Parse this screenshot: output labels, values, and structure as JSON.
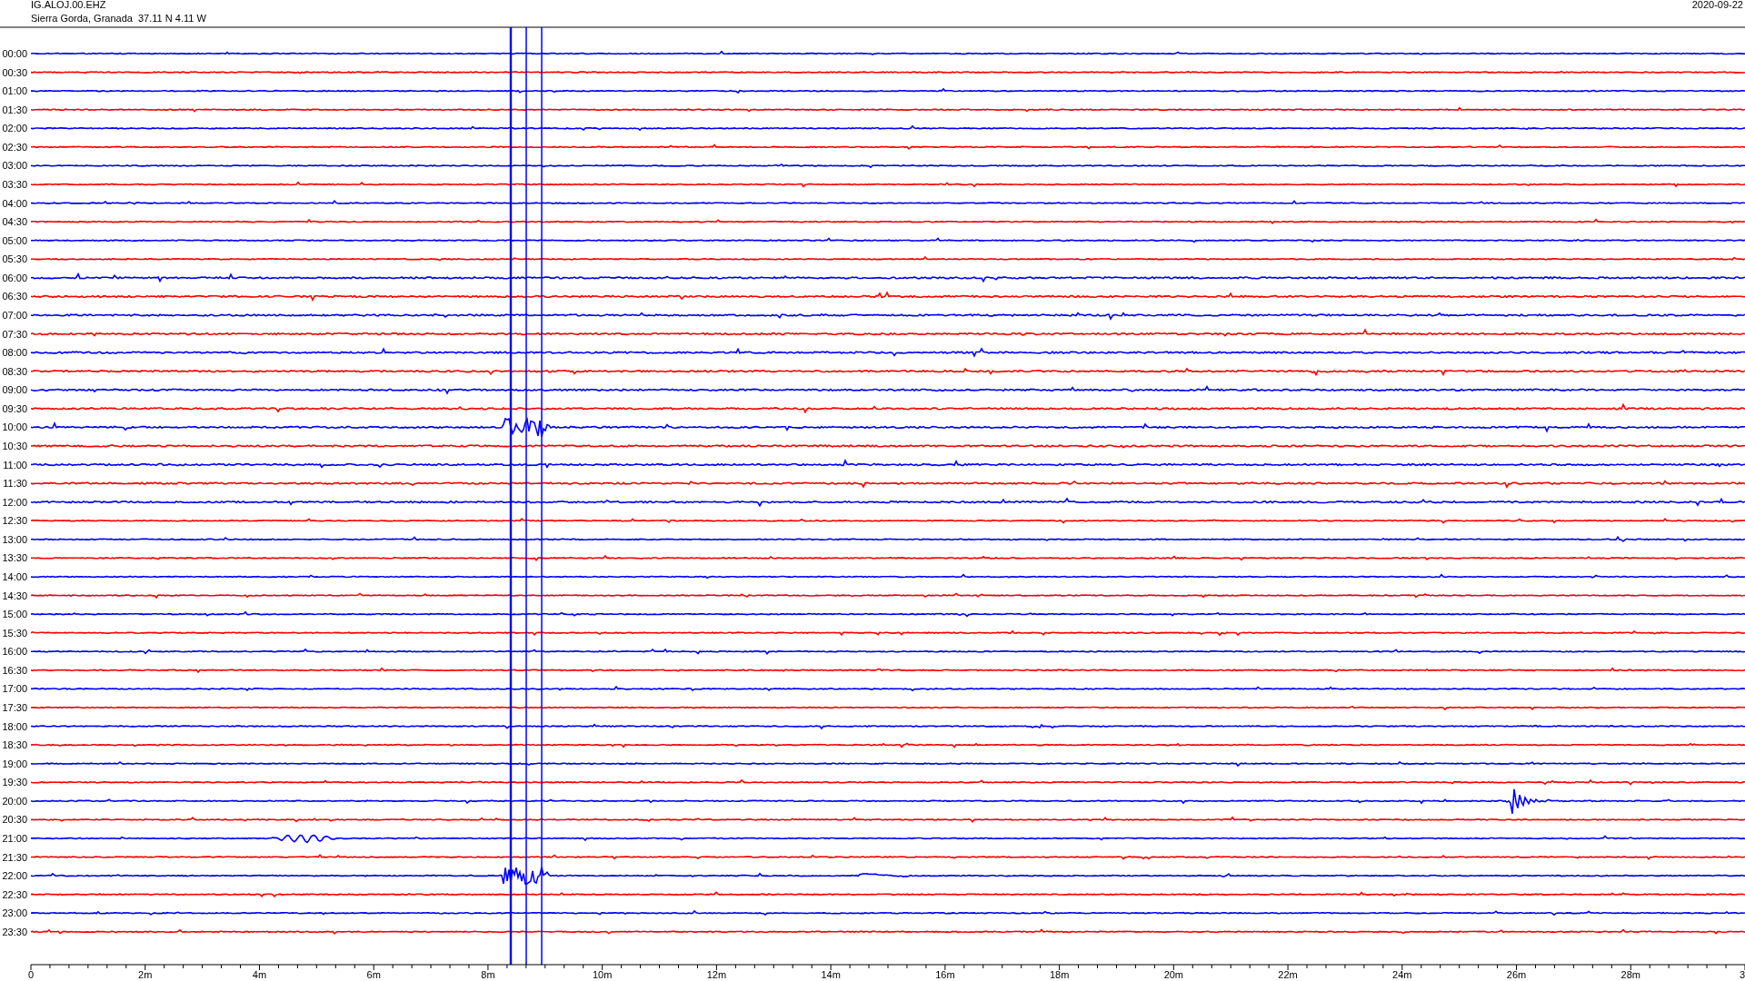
{
  "header": {
    "station": "IG.ALOJ.00.EHZ",
    "location": "Sierra Gorda, Granada  37.11 N 4.11 W",
    "date": "2020-09-22"
  },
  "traces": [
    {
      "label": "00:00",
      "color": "#0000ff"
    },
    {
      "label": "00:30",
      "color": "#ff0000"
    },
    {
      "label": "01:00",
      "color": "#0000ff"
    },
    {
      "label": "01:30",
      "color": "#ff0000"
    },
    {
      "label": "02:00",
      "color": "#0000ff"
    },
    {
      "label": "02:30",
      "color": "#ff0000"
    },
    {
      "label": "03:00",
      "color": "#0000ff"
    },
    {
      "label": "03:30",
      "color": "#ff0000"
    },
    {
      "label": "04:00",
      "color": "#0000ff"
    },
    {
      "label": "04:30",
      "color": "#ff0000"
    },
    {
      "label": "05:00",
      "color": "#0000ff"
    },
    {
      "label": "05:30",
      "color": "#ff0000"
    },
    {
      "label": "06:00",
      "color": "#0000ff"
    },
    {
      "label": "06:30",
      "color": "#ff0000"
    },
    {
      "label": "07:00",
      "color": "#0000ff"
    },
    {
      "label": "07:30",
      "color": "#ff0000"
    },
    {
      "label": "08:00",
      "color": "#0000ff"
    },
    {
      "label": "08:30",
      "color": "#ff0000"
    },
    {
      "label": "09:00",
      "color": "#0000ff"
    },
    {
      "label": "09:30",
      "color": "#ff0000"
    },
    {
      "label": "10:00",
      "color": "#0000ff"
    },
    {
      "label": "10:30",
      "color": "#ff0000"
    },
    {
      "label": "11:00",
      "color": "#0000ff"
    },
    {
      "label": "11:30",
      "color": "#ff0000"
    },
    {
      "label": "12:00",
      "color": "#0000ff"
    },
    {
      "label": "12:30",
      "color": "#ff0000"
    },
    {
      "label": "13:00",
      "color": "#0000ff"
    },
    {
      "label": "13:30",
      "color": "#ff0000"
    },
    {
      "label": "14:00",
      "color": "#0000ff"
    },
    {
      "label": "14:30",
      "color": "#ff0000"
    },
    {
      "label": "15:00",
      "color": "#0000ff"
    },
    {
      "label": "15:30",
      "color": "#ff0000"
    },
    {
      "label": "16:00",
      "color": "#0000ff"
    },
    {
      "label": "16:30",
      "color": "#ff0000"
    },
    {
      "label": "17:00",
      "color": "#0000ff"
    },
    {
      "label": "17:30",
      "color": "#ff0000"
    },
    {
      "label": "18:00",
      "color": "#0000ff"
    },
    {
      "label": "18:30",
      "color": "#ff0000"
    },
    {
      "label": "19:00",
      "color": "#0000ff"
    },
    {
      "label": "19:30",
      "color": "#ff0000"
    },
    {
      "label": "20:00",
      "color": "#0000ff"
    },
    {
      "label": "20:30",
      "color": "#ff0000"
    },
    {
      "label": "21:00",
      "color": "#0000ff"
    },
    {
      "label": "21:30",
      "color": "#ff0000"
    },
    {
      "label": "22:00",
      "color": "#0000ff"
    },
    {
      "label": "22:30",
      "color": "#ff0000"
    },
    {
      "label": "23:00",
      "color": "#0000ff"
    },
    {
      "label": "23:30",
      "color": "#ff0000"
    }
  ],
  "x_axis": {
    "ticks": [
      "0",
      "2m",
      "4m",
      "6m",
      "8m",
      "10m",
      "12m",
      "14m",
      "16m",
      "18m",
      "20m",
      "22m",
      "24m",
      "26m",
      "28m",
      "3"
    ]
  }
}
